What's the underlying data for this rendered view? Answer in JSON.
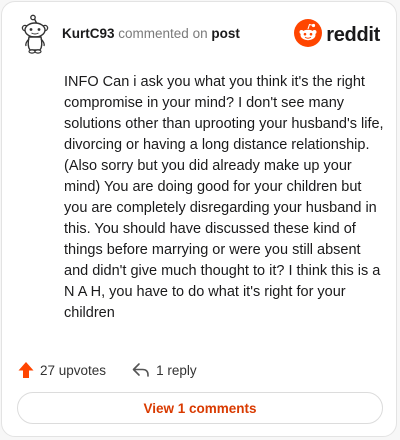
{
  "header": {
    "username": "KurtC93",
    "commented_on": "commented on",
    "post_link": "post",
    "logo_text": "reddit"
  },
  "comment": {
    "text": "INFO Can i ask you what you think it's the right compromise in your mind? I don't see many solutions other than uprooting your husband's life, divorcing or having a long distance relationship. (Also sorry but you did already make up your mind) You are doing good for your children but you are completely disregarding your husband in this. You should have discussed these kind of things before marrying or were you still absent and didn't give much thought to it? I think this is a N A H, you have to do what it's right for your children"
  },
  "actions": {
    "upvotes": "27 upvotes",
    "replies": "1 reply"
  },
  "footer": {
    "view_comments": "View 1 comments"
  },
  "colors": {
    "accent": "#d93a00",
    "upvote": "#ff4500",
    "logo": "#ff4500"
  },
  "icons": {
    "avatar": "snoo-avatar-icon",
    "logo": "reddit-logo-icon",
    "upvote": "upvote-arrow-icon",
    "reply": "reply-arrow-icon"
  }
}
